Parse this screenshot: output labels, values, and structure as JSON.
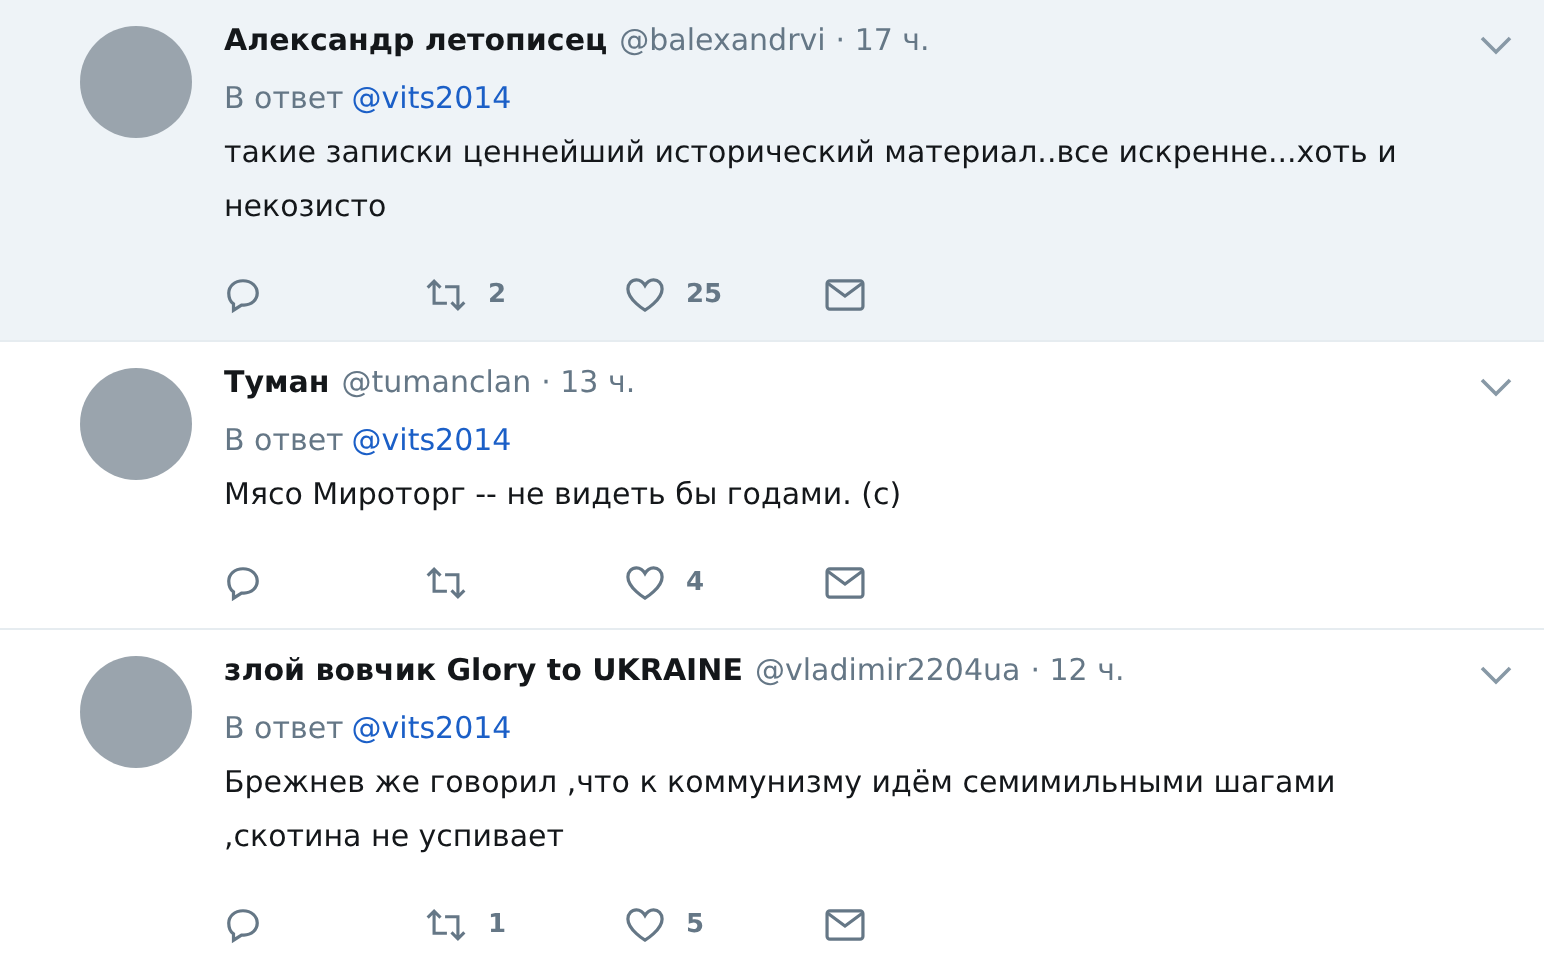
{
  "tweets": [
    {
      "name": "Александр летописец",
      "handle": "@balexandrvi",
      "time": "· 17 ч.",
      "reply_prefix": "В ответ",
      "reply_to": "@vits2014",
      "text": "такие записки ценнейший исторический материал..все искренне...хоть и некозисто",
      "retweets": "2",
      "likes": "25",
      "highlighted": true
    },
    {
      "name": "Туман",
      "handle": "@tumanclan",
      "time": "· 13 ч.",
      "reply_prefix": "В ответ",
      "reply_to": "@vits2014",
      "text": "Мясо Мироторг -- не видеть бы годами. (с)",
      "likes": "4",
      "highlighted": false
    },
    {
      "name": "злой вовчик Glory to UKRAINE",
      "handle": "@vladimir2204ua",
      "time": "· 12 ч.",
      "reply_prefix": "В ответ",
      "reply_to": "@vits2014",
      "text": "Брежнев же говорил ,что к коммунизму идём семимильными шагами ,скотина не успивает",
      "retweets": "1",
      "likes": "5",
      "highlighted": false
    }
  ]
}
